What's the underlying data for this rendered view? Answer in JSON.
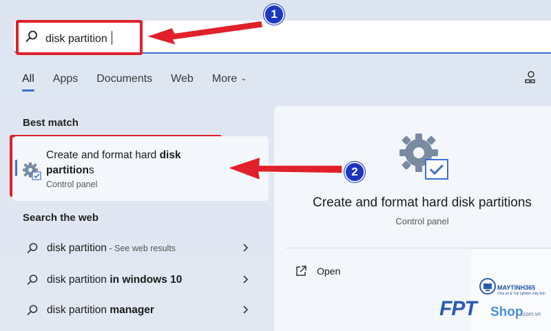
{
  "search": {
    "query": "disk partition"
  },
  "tabs": [
    {
      "label": "All",
      "active": true
    },
    {
      "label": "Apps"
    },
    {
      "label": "Documents"
    },
    {
      "label": "Web"
    },
    {
      "label": "More"
    }
  ],
  "best_match": {
    "heading": "Best match",
    "title_regular": "Create and format hard ",
    "title_bold": "disk",
    "title_line2_bold": "partition",
    "title_line2_tail": "s",
    "subtitle": "Control panel"
  },
  "web": {
    "heading": "Search the web",
    "results": [
      {
        "prefix": "disk partition",
        "bold": "",
        "hint": " - See web results"
      },
      {
        "prefix": "disk partition ",
        "bold": "in windows 10",
        "hint": ""
      },
      {
        "prefix": "disk partition ",
        "bold": "manager",
        "hint": ""
      }
    ]
  },
  "detail": {
    "title": "Create and format hard disk partitions",
    "subtitle": "Control panel",
    "open_label": "Open"
  },
  "annotations": {
    "badge1": "1",
    "badge2": "2",
    "highlight_color": "#e0202a",
    "badge_color": "#1c35c4"
  },
  "watermark": {
    "brand": "MAYTINH365",
    "tagline": "Chia sẻ & Trải nghiệm máy tính",
    "fpt_logo": "FPT",
    "shop": "Shop",
    "domain": ".com.vn"
  },
  "accent_color": "#3b6fd1"
}
